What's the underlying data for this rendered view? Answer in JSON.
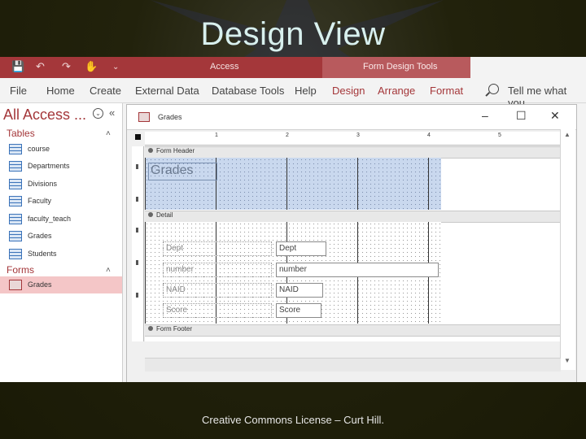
{
  "slide": {
    "title": "Design View",
    "footer": "Creative Commons License – Curt Hill."
  },
  "app": {
    "title": "Access",
    "context_tab_group": "Form Design Tools",
    "tabs": [
      "File",
      "Home",
      "Create",
      "External Data",
      "Database Tools",
      "Help",
      "Design",
      "Arrange",
      "Format"
    ],
    "tell_me": "Tell me what you"
  },
  "nav_pane": {
    "title": "All Access ...",
    "groups": [
      {
        "label": "Tables",
        "items": [
          "course",
          "Departments",
          "Divisions",
          "Faculty",
          "faculty_teach",
          "Grades",
          "Students"
        ]
      },
      {
        "label": "Forms",
        "items": [
          "Grades"
        ]
      }
    ],
    "selected_item": "Grades"
  },
  "document": {
    "tab_name": "Grades",
    "ruler_ticks": [
      "1",
      "2",
      "3",
      "4",
      "5"
    ],
    "sections": {
      "header": "Form Header",
      "detail": "Detail",
      "footer": "Form Footer"
    },
    "header_label": "Grades",
    "fields": [
      {
        "label": "Dept",
        "control": "Dept"
      },
      {
        "label": "number",
        "control": "number"
      },
      {
        "label": "NAID",
        "control": "NAID"
      },
      {
        "label": "Score",
        "control": "Score"
      }
    ]
  },
  "colors": {
    "access_red": "#a4373a",
    "selected_nav": "#f4c6c7",
    "header_section": "#c9d8ee"
  }
}
